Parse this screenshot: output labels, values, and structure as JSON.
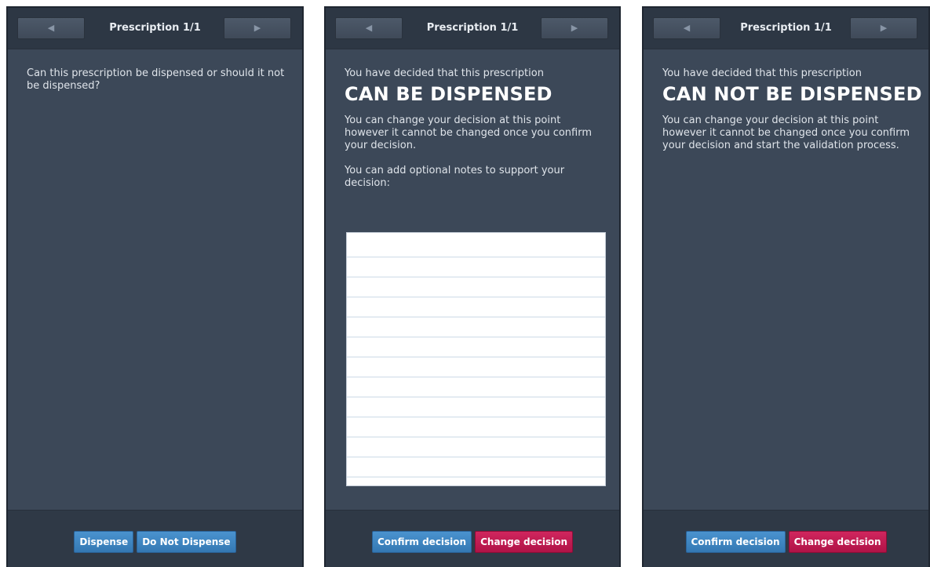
{
  "panels": [
    {
      "header": {
        "title": "Prescription 1/1",
        "prev_icon": "◀",
        "next_icon": "▶"
      },
      "question": "Can this prescription be dispensed or should it not be dispensed?",
      "buttons": {
        "dispense": "Dispense",
        "do_not_dispense": "Do Not Dispense"
      }
    },
    {
      "header": {
        "title": "Prescription 1/1",
        "prev_icon": "◀",
        "next_icon": "▶"
      },
      "intro": "You have decided that this prescription",
      "decision": "CAN BE DISPENSED",
      "info": "You can change your decision at this point however it cannot be changed once you confirm your decision.",
      "notes_label": "You can add optional notes to support your decision:",
      "notes_value": "",
      "buttons": {
        "confirm": "Confirm decision",
        "change": "Change decision"
      }
    },
    {
      "header": {
        "title": "Prescription 1/1",
        "prev_icon": "◀",
        "next_icon": "▶"
      },
      "intro": "You have decided that this prescription",
      "decision": "CAN NOT BE DISPENSED",
      "info": "You can change your decision at this point however it cannot be changed once you confirm your decision and start the validation process.",
      "buttons": {
        "confirm": "Confirm decision",
        "change": "Change decision"
      }
    }
  ],
  "colors": {
    "panel_bg": "#3c4858",
    "header_bg": "#2d3744",
    "footer_bg": "#2f3946",
    "primary_button": "#3a82be",
    "danger_button": "#c11a52"
  }
}
